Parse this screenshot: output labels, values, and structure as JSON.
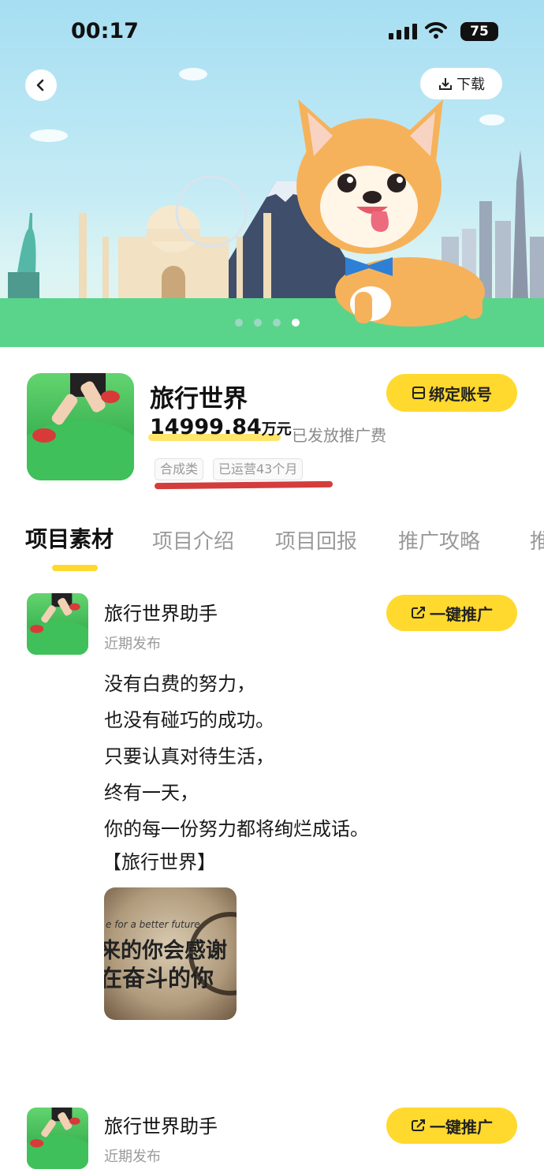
{
  "status_bar": {
    "time": "00:17",
    "battery": "75"
  },
  "banner": {
    "download_label": "下载",
    "page_dots": 4,
    "active_dot": 4
  },
  "app": {
    "name": "旅行世界",
    "amount_number": "14999.84",
    "amount_unit": "万元",
    "amount_caption": "已发放推广费",
    "tags": [
      "合成类",
      "已运营43个月"
    ],
    "bind_button": "绑定账号"
  },
  "tabs": [
    "项目素材",
    "项目介绍",
    "项目回报",
    "推广攻略",
    "推"
  ],
  "active_tab": 0,
  "posts": [
    {
      "author": "旅行世界助手",
      "date": "近期发布",
      "promote_button": "一键推广",
      "lines": [
        "没有白费的努力，",
        "也没有碰巧的成功。",
        "只要认真对待生活，",
        "终有一天，",
        "你的每一份努力都将绚烂成话。",
        "【旅行世界】"
      ],
      "image_text": {
        "small": "e for a better future",
        "line1": "来的你会感谢",
        "line2": "在奋斗的你"
      }
    },
    {
      "author": "旅行世界助手",
      "date": "近期发布",
      "promote_button": "一键推广"
    }
  ],
  "colors": {
    "accent_yellow": "#ffd92e",
    "highlight_red": "#d43d3d",
    "banner_sky": "#a6def2",
    "grass_green": "#5ad48a"
  }
}
